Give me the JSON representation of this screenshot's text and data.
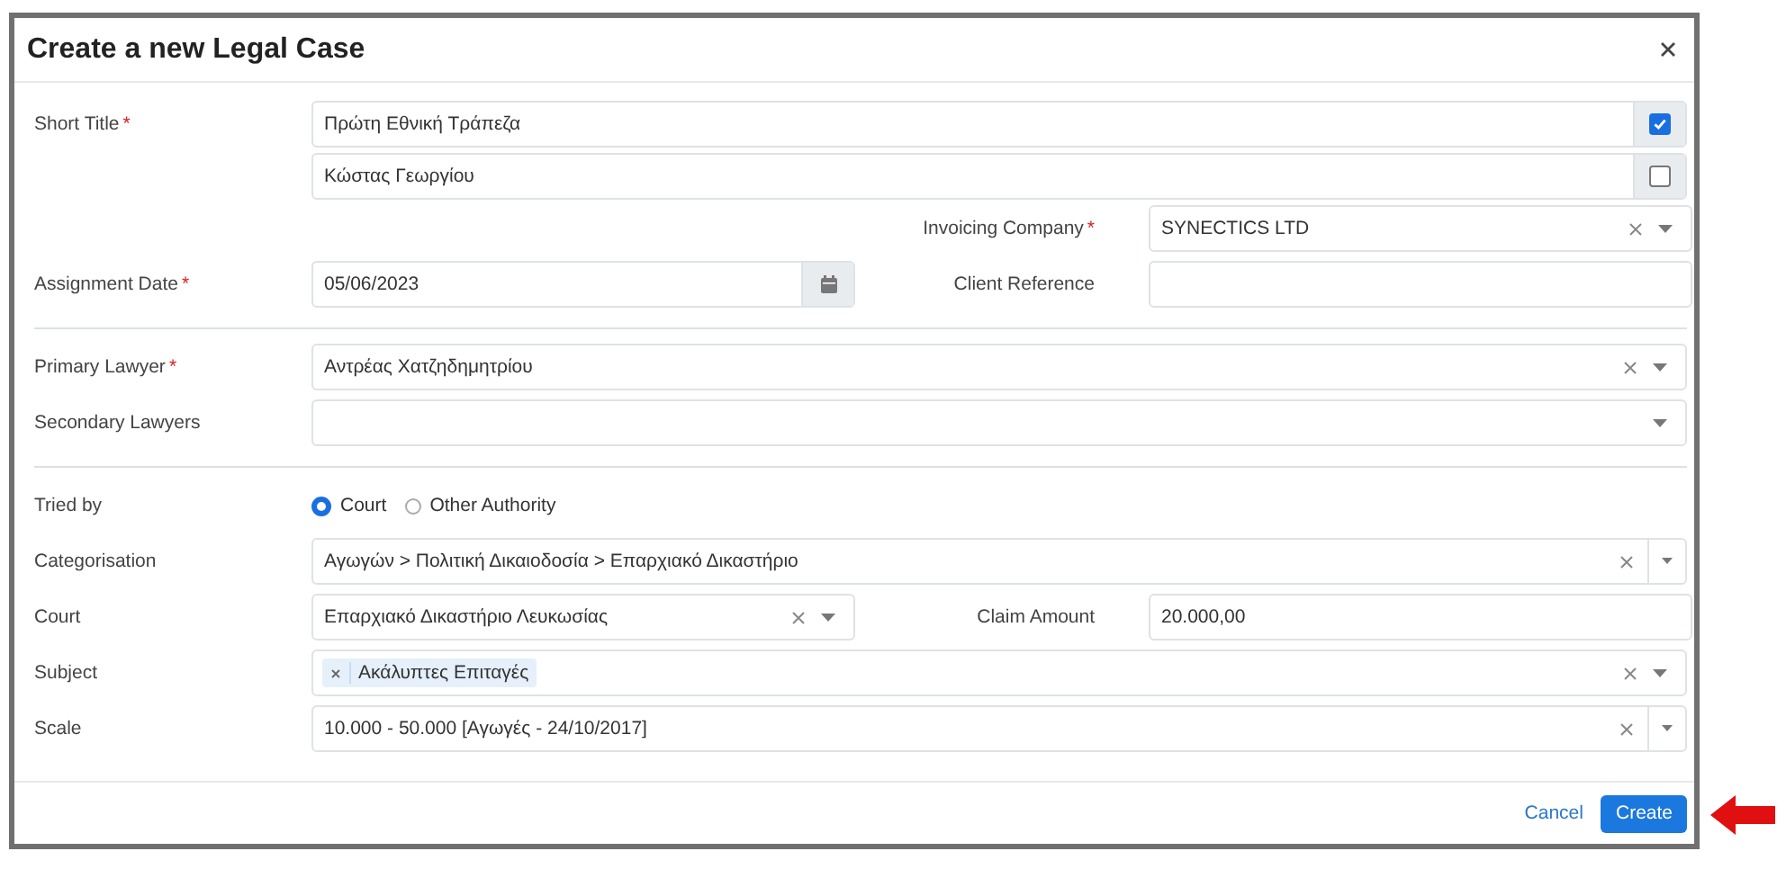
{
  "dialog": {
    "title": "Create a new Legal Case"
  },
  "sections": [
    {
      "rows": [
        {
          "kind": "text_check",
          "label": "Short Title",
          "required": "*",
          "value": "Πρώτη Εθνική Τράπεζα",
          "checked": true
        },
        {
          "kind": "text_check",
          "value": "Κώστας Γεωργίου",
          "checked": false
        },
        {
          "kind": "right_select",
          "right_label": "Invoicing Company",
          "required": "*",
          "value": "SYNECTICS LTD",
          "clearable": true
        },
        {
          "kind": "date_pair",
          "label": "Assignment Date",
          "required": "*",
          "value": "05/06/2023",
          "right_label": "Client Reference"
        }
      ]
    },
    {
      "rows": [
        {
          "kind": "select",
          "label": "Primary Lawyer",
          "required": "*",
          "value": "Αντρέας Χατζηδημητρίου",
          "clearable": true,
          "split": false
        },
        {
          "kind": "select",
          "label": "Secondary Lawyers",
          "clearable": false,
          "split": false
        }
      ]
    },
    {
      "rows": [
        {
          "kind": "radio",
          "label": "Tried by",
          "options": [
            {
              "label": "Court",
              "selected": true
            },
            {
              "label": "Other Authority",
              "selected": false
            }
          ]
        },
        {
          "kind": "select",
          "label": "Categorisation",
          "value": "Αγωγών > Πολιτική Δικαιοδοσία > Επαρχιακό Δικαστήριο",
          "clearable": true,
          "split": true
        },
        {
          "kind": "select_pair",
          "label": "Court",
          "value": "Επαρχιακό Δικαστήριο Λευκωσίας",
          "clearable": true,
          "right_label": "Claim Amount",
          "right_value": "20.000,00"
        },
        {
          "kind": "tags",
          "label": "Subject",
          "tags": [
            {
              "label": "Ακάλυπτες Επιταγές"
            }
          ],
          "clearable": true
        },
        {
          "kind": "select",
          "label": "Scale",
          "value": "10.000 - 50.000 [Αγωγές - 24/10/2017]",
          "clearable": true,
          "split": true
        }
      ]
    }
  ],
  "footer": {
    "cancel": "Cancel",
    "create": "Create",
    "pointer": true
  }
}
